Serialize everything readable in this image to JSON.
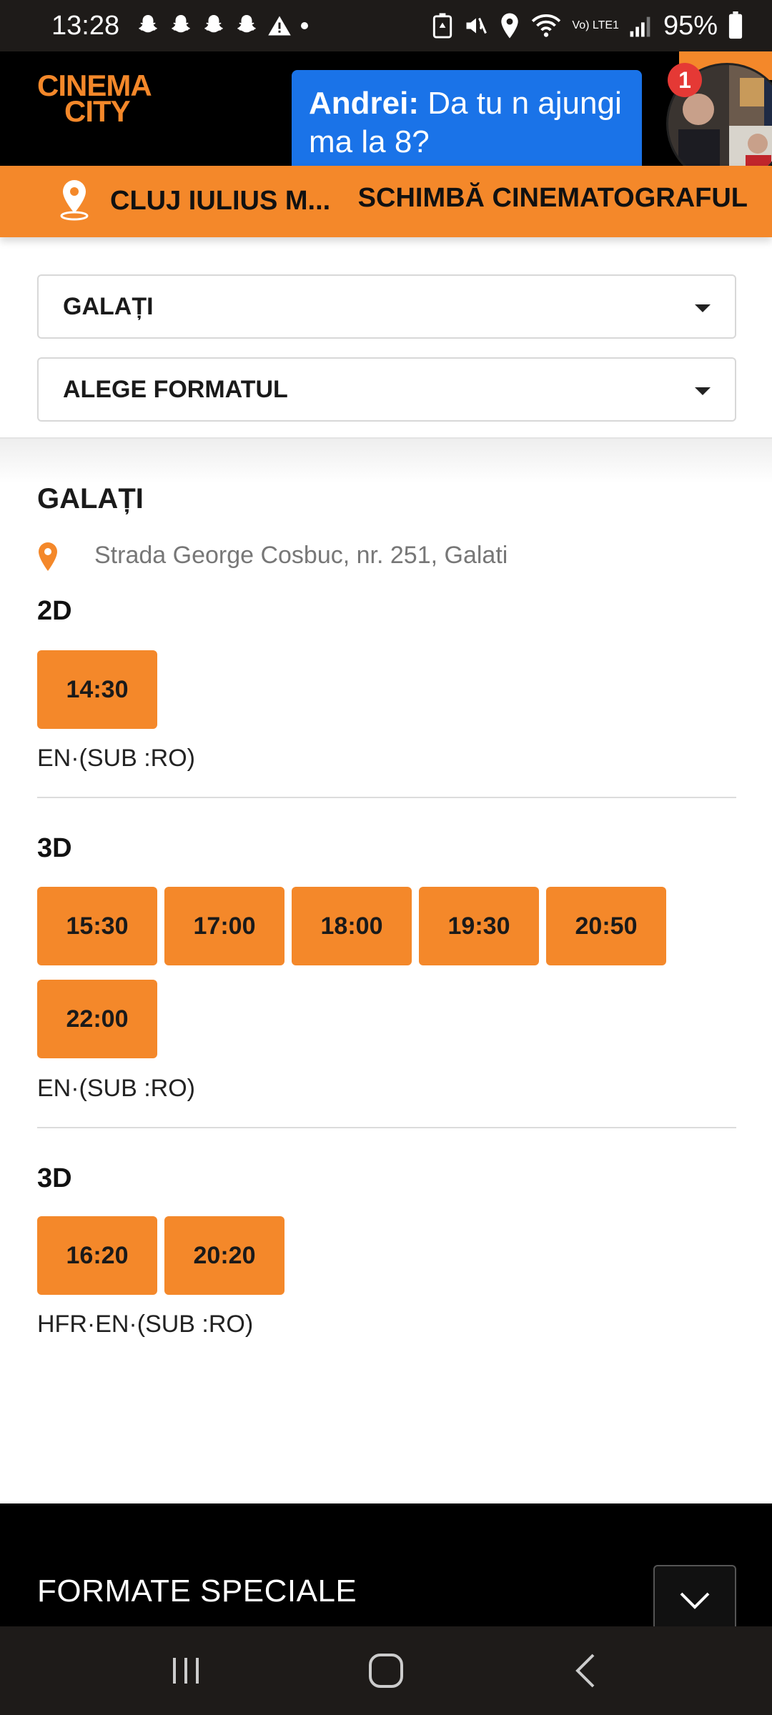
{
  "status_bar": {
    "time": "13:28",
    "battery": "95%",
    "network_label": "Vo) LTE1"
  },
  "header": {
    "logo_line1": "CINEMA",
    "logo_line2": "CITY"
  },
  "notification": {
    "sender": "Andrei:",
    "message": " Da tu n ajungi ma la 8?",
    "badge_count": "1"
  },
  "location_bar": {
    "cinema_name": "CLUJ IULIUS M...",
    "change_label": "SCHIMBĂ CINEMATOGRAFUL"
  },
  "filters": {
    "city_select": "GALAȚI",
    "format_select": "ALEGE FORMATUL"
  },
  "cinema": {
    "title": "GALAȚI",
    "address": "Strada George Cosbuc, nr. 251, Galati",
    "screenings": [
      {
        "format": "2D",
        "times": [
          "14:30"
        ],
        "language": "EN·(SUB :RO)"
      },
      {
        "format": "3D",
        "times": [
          "15:30",
          "17:00",
          "18:00",
          "19:30",
          "20:50",
          "22:00"
        ],
        "language": "EN·(SUB :RO)"
      },
      {
        "format": "3D",
        "times": [
          "16:20",
          "20:20"
        ],
        "language": "HFR·EN·(SUB :RO)"
      }
    ]
  },
  "footer": {
    "title": "FORMATE SPECIALE"
  },
  "colors": {
    "accent": "#f4882a",
    "header_bg": "#000000",
    "notification_bg": "#1a73e8"
  }
}
